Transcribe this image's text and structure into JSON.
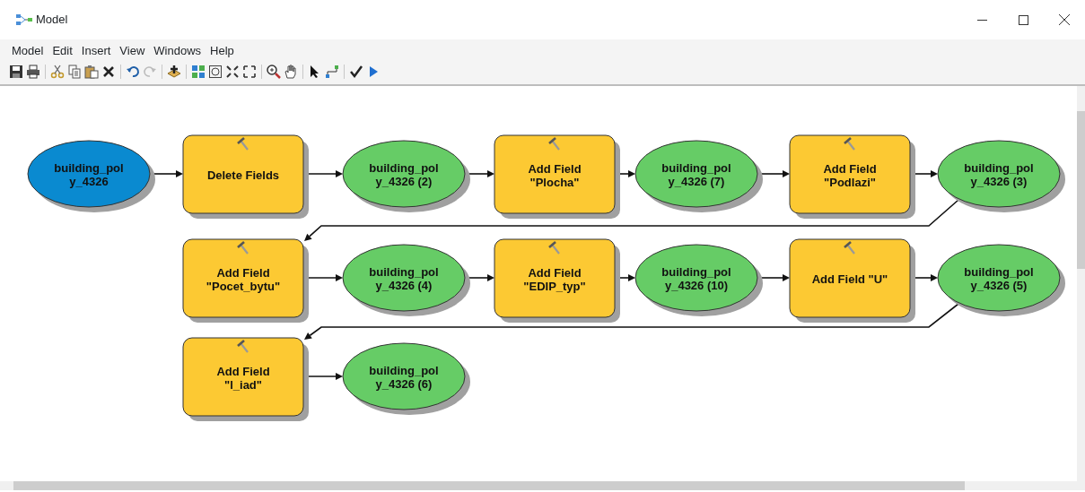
{
  "window": {
    "title": "Model"
  },
  "menu": [
    "Model",
    "Edit",
    "Insert",
    "View",
    "Windows",
    "Help"
  ],
  "diagram": {
    "nodes": [
      {
        "kind": "input",
        "lines": [
          "building_pol",
          "y_4326"
        ]
      },
      {
        "kind": "tool",
        "lines": [
          "Delete Fields"
        ]
      },
      {
        "kind": "output",
        "lines": [
          "building_pol",
          "y_4326 (2)"
        ]
      },
      {
        "kind": "tool",
        "lines": [
          "Add Field",
          "\"Plocha\""
        ]
      },
      {
        "kind": "output",
        "lines": [
          "building_pol",
          "y_4326 (7)"
        ]
      },
      {
        "kind": "tool",
        "lines": [
          "Add Field",
          "\"Podlazi\""
        ]
      },
      {
        "kind": "output",
        "lines": [
          "building_pol",
          "y_4326 (3)"
        ]
      },
      {
        "kind": "tool",
        "lines": [
          "Add Field",
          "\"Pocet_bytu\""
        ]
      },
      {
        "kind": "output",
        "lines": [
          "building_pol",
          "y_4326 (4)"
        ]
      },
      {
        "kind": "tool",
        "lines": [
          "Add Field",
          "\"EDIP_typ\""
        ]
      },
      {
        "kind": "output",
        "lines": [
          "building_pol",
          "y_4326 (10)"
        ]
      },
      {
        "kind": "tool",
        "lines": [
          "Add Field \"U\""
        ]
      },
      {
        "kind": "output",
        "lines": [
          "building_pol",
          "y_4326 (5)"
        ]
      },
      {
        "kind": "tool",
        "lines": [
          "Add Field",
          "\"l_iad\""
        ]
      },
      {
        "kind": "output",
        "lines": [
          "building_pol",
          "y_4326 (6)"
        ]
      }
    ]
  }
}
